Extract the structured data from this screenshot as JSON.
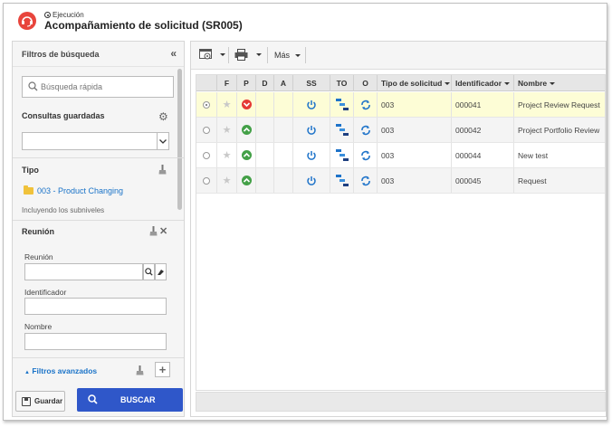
{
  "header": {
    "breadcrumb": "Ejecución",
    "title": "Acompañamiento de solicitud (SR005)"
  },
  "filters": {
    "title": "Filtros de búsqueda",
    "quick_search_placeholder": "Búsqueda rápida",
    "saved_queries_label": "Consultas guardadas",
    "saved_queries_value": "",
    "type_label": "Tipo",
    "type_value": "003 - Product Changing",
    "type_sublevels": "Incluyendo los subniveles",
    "meeting_section": "Reunión",
    "meeting_field_label": "Reunión",
    "identifier_label": "Identificador",
    "name_label": "Nombre",
    "advanced_filters": "Filtros avanzados",
    "save_button": "Guardar",
    "search_button": "BUSCAR"
  },
  "toolbar": {
    "more_label": "Más"
  },
  "grid": {
    "columns": {
      "f": "F",
      "p": "P",
      "d": "D",
      "a": "A",
      "ss": "SS",
      "to": "TO",
      "o": "O",
      "type": "Tipo de solicitud",
      "identifier": "Identificador",
      "name": "Nombre"
    },
    "rows": [
      {
        "type": "003",
        "identifier": "000041",
        "name": "Project Review Request",
        "priority": "down",
        "selected": true
      },
      {
        "type": "003",
        "identifier": "000042",
        "name": "Project Portfolio Review",
        "priority": "up",
        "selected": false
      },
      {
        "type": "003",
        "identifier": "000044",
        "name": "New test",
        "priority": "up",
        "selected": false
      },
      {
        "type": "003",
        "identifier": "000045",
        "name": "Request",
        "priority": "up",
        "selected": false
      }
    ]
  },
  "colors": {
    "accent": "#2f57c9",
    "link": "#1a73c8",
    "selected_row": "#fdfdd6",
    "priority_high": "#e53935",
    "priority_normal": "#43a047",
    "status_icon": "#1e73c9"
  },
  "icons": {
    "logo": "support-headset-icon",
    "collapse": "double-chevron-left-icon",
    "search": "search-icon",
    "gear": "gear-icon",
    "broom": "broom-icon",
    "folder": "folder-icon",
    "print": "printer-icon",
    "view": "view-icon",
    "power": "power-icon",
    "workflow": "workflow-icon",
    "refresh": "refresh-icon"
  }
}
